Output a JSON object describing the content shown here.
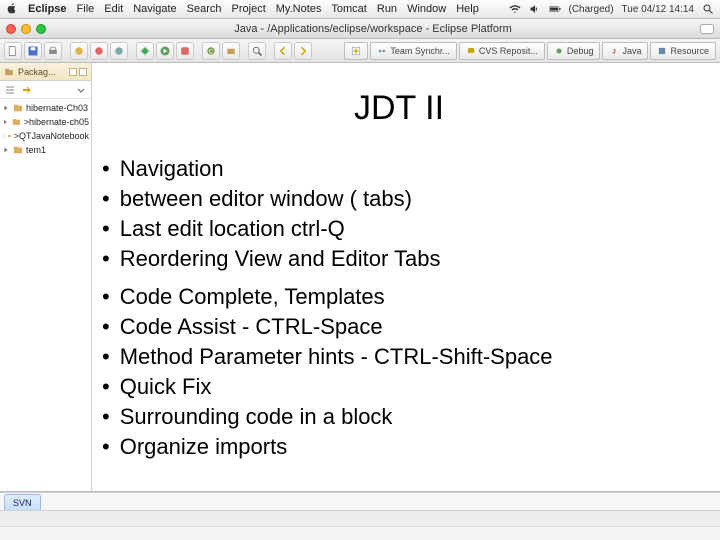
{
  "mac_menu": {
    "app": "Eclipse",
    "items": [
      "File",
      "Edit",
      "Navigate",
      "Search",
      "Project",
      "My.Notes",
      "Tomcat",
      "Run",
      "Window",
      "Help"
    ],
    "status": {
      "battery": "(Charged)",
      "clock": "Tue 04/12 14:14"
    }
  },
  "window": {
    "title": "Java - /Applications/eclipse/workspace - Eclipse Platform"
  },
  "perspectives": [
    {
      "name": "team-sync",
      "label": "Team Synchr..."
    },
    {
      "name": "cvs",
      "label": "CVS Reposit..."
    },
    {
      "name": "debug",
      "label": "Debug"
    },
    {
      "name": "java",
      "label": "Java"
    },
    {
      "name": "resource",
      "label": "Resource"
    }
  ],
  "sidebar": {
    "tab_label": "Packag...",
    "projects": [
      "hibernate-Ch03",
      ">hibernate-ch05",
      ">QTJavaNotebook",
      "tem1"
    ]
  },
  "slide": {
    "title": "JDT  II",
    "bullets": [
      {
        "text": "Navigation",
        "sub": [
          "between editor window ( tabs)",
          "Last edit location ctrl-Q",
          "Reordering View and Editor Tabs"
        ]
      },
      {
        "text": "Code Complete, Templates"
      },
      {
        "text": "Code Assist - CTRL-Space"
      },
      {
        "text": "Method Parameter hints - CTRL-Shift-Space"
      },
      {
        "text": "Quick Fix"
      },
      {
        "text": "Surrounding code in a block"
      },
      {
        "text": "Organize imports"
      }
    ]
  },
  "bottom_tabs": [
    {
      "label": "SVN",
      "active": true
    }
  ]
}
